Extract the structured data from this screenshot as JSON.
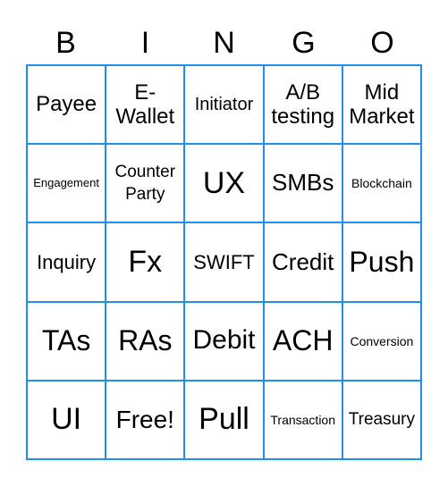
{
  "header": [
    "B",
    "I",
    "N",
    "G",
    "O"
  ],
  "cells": [
    [
      "Payee",
      "E-\nWallet",
      "Initiator",
      "A/B\ntesting",
      "Mid\nMarket"
    ],
    [
      "Engagement",
      "Counter\nParty",
      "UX",
      "SMBs",
      "Blockchain"
    ],
    [
      "Inquiry",
      "Fx",
      "SWIFT",
      "Credit",
      "Push"
    ],
    [
      "TAs",
      "RAs",
      "Debit",
      "ACH",
      "Conversion"
    ],
    [
      "UI",
      "Free!",
      "Pull",
      "Transaction",
      "Treasury"
    ]
  ],
  "colors": {
    "grid_border": "#1e90f0",
    "text": "#000000"
  }
}
